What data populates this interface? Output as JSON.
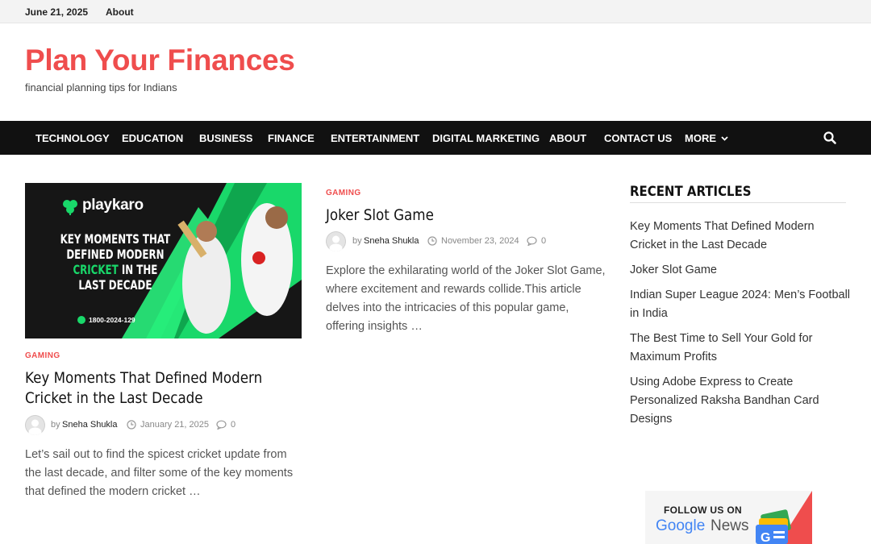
{
  "topbar": {
    "date": "June 21, 2025",
    "about": "About"
  },
  "site": {
    "title": "Plan Your Finances",
    "tagline": "financial planning tips for Indians",
    "accent": "#ef4d4d"
  },
  "nav": {
    "items": [
      "TECHNOLOGY",
      "EDUCATION",
      "BUSINESS",
      "FINANCE",
      "ENTERTAINMENT",
      "DIGITAL MARKETING",
      "ABOUT",
      "CONTACT US",
      "MORE"
    ],
    "search_icon": "search-icon"
  },
  "posts": [
    {
      "thumbnail": {
        "brand": "playkaro",
        "headline_lines": [
          "KEY MOMENTS THAT",
          "DEFINED MODERN",
          "IN THE",
          "LAST DECADE"
        ],
        "headline_highlight": "CRICKET",
        "phone": "1800-2024-129"
      },
      "category": "GAMING",
      "title": "Key Moments That Defined Modern Cricket in the Last Decade",
      "by": "by",
      "author": "Sneha Shukla",
      "date": "January 21, 2025",
      "comments": "0",
      "excerpt": "Let’s sail out to find the spicest cricket update from the last decade, and filter some of the key moments that defined the modern cricket …"
    },
    {
      "category": "GAMING",
      "title": "Joker Slot Game",
      "by": "by",
      "author": "Sneha Shukla",
      "date": "November 23, 2024",
      "comments": "0",
      "excerpt": "Explore the exhilarating world of the Joker Slot Game, where excitement and rewards collide.This article delves into the intricacies of this popular game, offering insights …"
    }
  ],
  "sidebar": {
    "title": "RECENT ARTICLES",
    "items": [
      "Key Moments That Defined Modern Cricket in the Last Decade",
      "Joker Slot Game",
      "Indian Super League 2024: Men’s Football in India",
      "The Best Time to Sell Your Gold for Maximum Profits",
      "Using Adobe Express to Create Personalized Raksha Bandhan Card Designs"
    ]
  },
  "google_news": {
    "follow": "FOLLOW US ON",
    "google": "Google",
    "news": "News"
  }
}
